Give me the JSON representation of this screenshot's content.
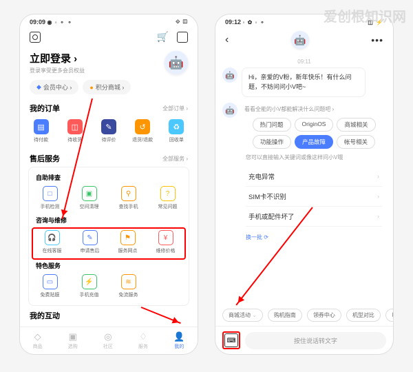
{
  "watermark": "爱创根知识网",
  "left": {
    "time": "09:09",
    "status_icons": "◉ ◦ ⚬ ⚬",
    "signal": "⟐ ◫",
    "login_title": "立即登录 ›",
    "login_sub": "登录享受更多会员权益",
    "pills": {
      "member": "会员中心 ›",
      "points": "积分商城 ›"
    },
    "orders": {
      "title": "我的订单",
      "link": "全部订单 ›",
      "items": [
        "待付款",
        "待收货",
        "待评价",
        "退货/退款",
        "回收单"
      ]
    },
    "service": {
      "title": "售后服务",
      "link": "全部服务 ›",
      "self_title": "自助排查",
      "self_items": [
        "手机检测",
        "空间清理",
        "查找手机",
        "常见问题"
      ],
      "consult_title": "咨询与维修",
      "consult_items": [
        "在线客服",
        "申请售后",
        "服务网点",
        "维修价格"
      ],
      "special_title": "特色服务",
      "special_items": [
        "免费贴膜",
        "手机充值",
        "免流服务"
      ]
    },
    "interact": {
      "title": "我的互动"
    },
    "nav": [
      "商品",
      "选购",
      "社区",
      "服务",
      "我的"
    ]
  },
  "right": {
    "time": "09:12",
    "status_icons": "◦ ✿ ◦ ⚬",
    "signal": "◫ ⚡",
    "chat_time": "09:11",
    "greeting": "Hi，亲爱的V粉，新年快乐！有什么问题，不妨问问小V吧~",
    "hint1": "看看全能的小V都能解决什么问题吧 ›",
    "chips": [
      "热门问题",
      "OriginOS",
      "商城相关",
      "功能操作",
      "产品故障",
      "帐号相关"
    ],
    "active_chip": 4,
    "hint2": "您可以直接输入关键词或像这样问小V哦",
    "questions": [
      "充电异常",
      "SIM卡不识别",
      "手机或配件坏了"
    ],
    "refresh": "换一批 ⟳",
    "bottom_chips": [
      "商城活动",
      "购机指南",
      "领券中心",
      "机型对比",
      "以"
    ],
    "voice_placeholder": "按住说话转文字"
  }
}
